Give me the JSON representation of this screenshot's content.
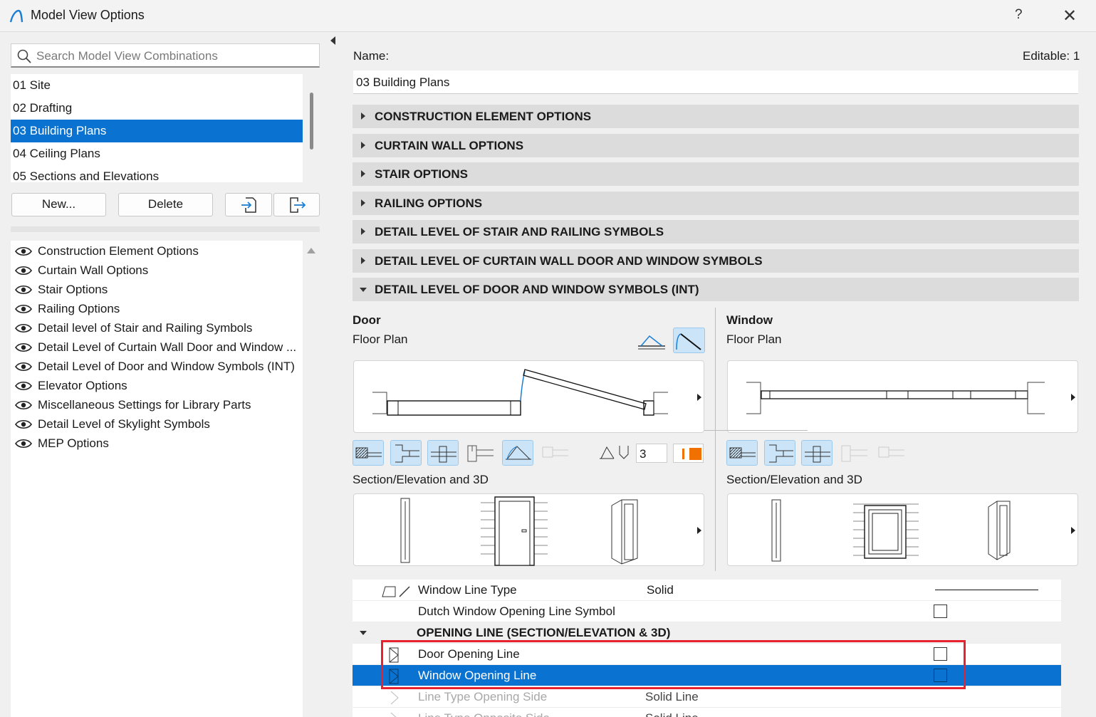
{
  "window": {
    "title": "Model View Options",
    "help": "?",
    "close": "✕"
  },
  "search": {
    "placeholder": "Search Model View Combinations"
  },
  "combinations": [
    {
      "label": "01 Site",
      "selected": false
    },
    {
      "label": "02 Drafting",
      "selected": false
    },
    {
      "label": "03 Building Plans",
      "selected": true
    },
    {
      "label": "04 Ceiling Plans",
      "selected": false
    },
    {
      "label": "05 Sections and Elevations",
      "selected": false
    }
  ],
  "buttons": {
    "new": "New...",
    "delete": "Delete",
    "import_icon": "import-icon",
    "export_icon": "export-icon"
  },
  "option_sets": [
    "Construction Element Options",
    "Curtain Wall Options",
    "Stair Options",
    "Railing Options",
    "Detail level of Stair and Railing Symbols",
    "Detail Level of Curtain Wall Door and Window ...",
    "Detail Level of Door and Window Symbols (INT)",
    "Elevator Options",
    "Miscellaneous Settings for Library Parts",
    "Detail Level of Skylight Symbols",
    "MEP Options"
  ],
  "details": {
    "name_label": "Name:",
    "editable": "Editable: 1",
    "name_value": "03 Building Plans"
  },
  "sections": [
    {
      "label": "CONSTRUCTION ELEMENT OPTIONS",
      "expanded": false
    },
    {
      "label": "CURTAIN WALL OPTIONS",
      "expanded": false
    },
    {
      "label": "STAIR OPTIONS",
      "expanded": false
    },
    {
      "label": "RAILING OPTIONS",
      "expanded": false
    },
    {
      "label": "DETAIL LEVEL OF STAIR AND RAILING SYMBOLS",
      "expanded": false
    },
    {
      "label": "DETAIL LEVEL OF CURTAIN WALL DOOR AND WINDOW SYMBOLS",
      "expanded": false
    },
    {
      "label": "DETAIL LEVEL OF DOOR AND WINDOW SYMBOLS (INT)",
      "expanded": true
    }
  ],
  "door": {
    "title": "Door",
    "floor_plan": "Floor Plan",
    "section": "Section/Elevation and 3D",
    "swing_value": "3"
  },
  "window_panel": {
    "title": "Window",
    "floor_plan": "Floor Plan",
    "section": "Section/Elevation and 3D"
  },
  "table": {
    "rows": [
      {
        "label": "Window Line Type",
        "value": "Solid",
        "type": "line"
      },
      {
        "label": "Dutch Window Opening Line Symbol",
        "value": "",
        "type": "checkbox"
      },
      {
        "label": "OPENING LINE (SECTION/ELEVATION & 3D)",
        "type": "group"
      },
      {
        "label": "Door Opening Line",
        "type": "checkbox"
      },
      {
        "label": "Window Opening Line",
        "type": "checkbox",
        "selected": true
      },
      {
        "label": "Line Type Opening Side",
        "value": "Solid Line",
        "type": "disabled"
      },
      {
        "label": "Line Type Opposite Side",
        "value": "Solid Line",
        "type": "disabled"
      }
    ]
  },
  "colors": {
    "accent": "#0a73d1",
    "highlight": "#e8212e",
    "orange": "#f07000"
  }
}
